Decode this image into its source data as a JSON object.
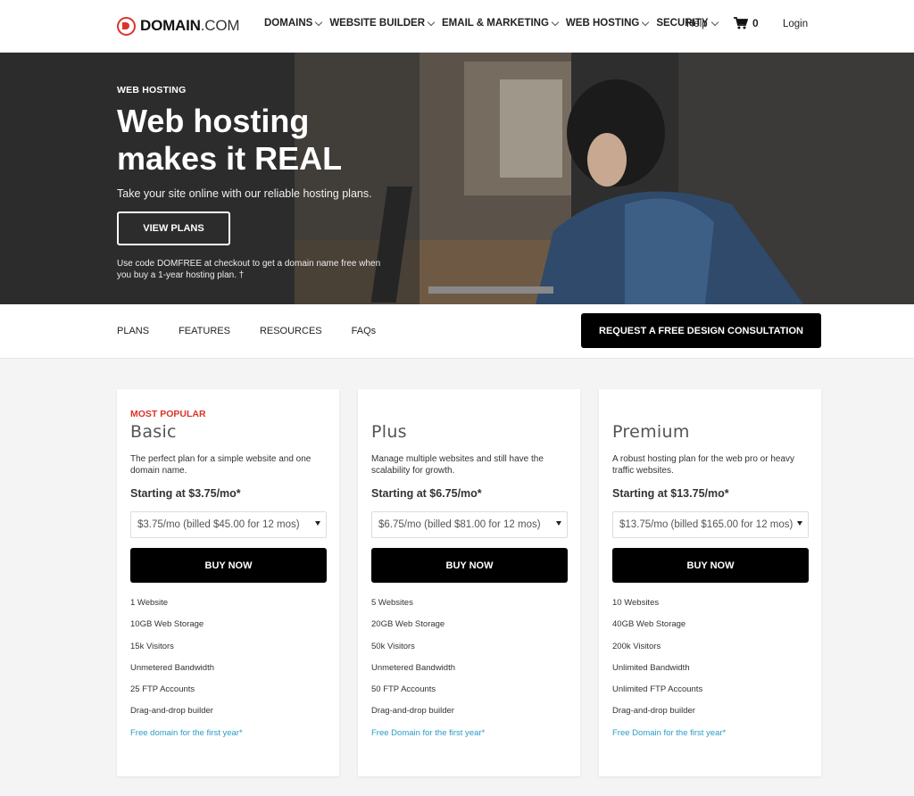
{
  "header": {
    "logo_text_bold": "DOMAIN",
    "logo_text_rest": ".COM",
    "nav": [
      "DOMAINS",
      "WEBSITE BUILDER",
      "EMAIL & MARKETING",
      "WEB HOSTING",
      "SECURITY"
    ],
    "help": "Help",
    "cart_count": "0",
    "login": "Login"
  },
  "hero": {
    "eyebrow": "WEB HOSTING",
    "title": "Web hosting makes it REAL",
    "subtitle": "Take your site online with our reliable hosting plans.",
    "cta": "VIEW PLANS",
    "promo": "Use code DOMFREE at checkout to get a domain name free when you buy a 1-year hosting plan. †"
  },
  "subnav": {
    "links": [
      "PLANS",
      "FEATURES",
      "RESOURCES",
      "FAQs"
    ],
    "consult": "REQUEST A FREE DESIGN CONSULTATION"
  },
  "plans": [
    {
      "badge": "MOST POPULAR",
      "name": "Basic",
      "desc": "The perfect plan for a simple website and one domain name.",
      "start": "Starting at $3.75/mo*",
      "select": "$3.75/mo (billed $45.00 for 12 mos)",
      "buy": "BUY NOW",
      "features": [
        "1 Website",
        "10GB Web Storage",
        "15k Visitors",
        "Unmetered Bandwidth",
        "25 FTP Accounts",
        "Drag-and-drop builder",
        "Free domain for the first year*"
      ]
    },
    {
      "badge": "",
      "name": "Plus",
      "desc": "Manage multiple websites and still have the scalability for growth.",
      "start": "Starting at $6.75/mo*",
      "select": "$6.75/mo (billed $81.00 for 12 mos)",
      "buy": "BUY NOW",
      "features": [
        "5 Websites",
        "20GB Web Storage",
        "50k Visitors",
        "Unmetered Bandwidth",
        "50 FTP Accounts",
        "Drag-and-drop builder",
        "Free Domain for the first year*"
      ]
    },
    {
      "badge": "",
      "name": "Premium",
      "desc": "A robust hosting plan for the web pro or heavy traffic websites.",
      "start": "Starting at $13.75/mo*",
      "select": "$13.75/mo (billed $165.00 for 12 mos)",
      "buy": "BUY NOW",
      "features": [
        "10 Websites",
        "40GB Web Storage",
        "200k Visitors",
        "Unlimited Bandwidth",
        "Unlimited FTP Accounts",
        "Drag-and-drop builder",
        "Free Domain for the first year*"
      ]
    }
  ],
  "colors": {
    "brand_red": "#d9352c",
    "link_blue": "#2a9bc7",
    "button_black": "#000000"
  }
}
